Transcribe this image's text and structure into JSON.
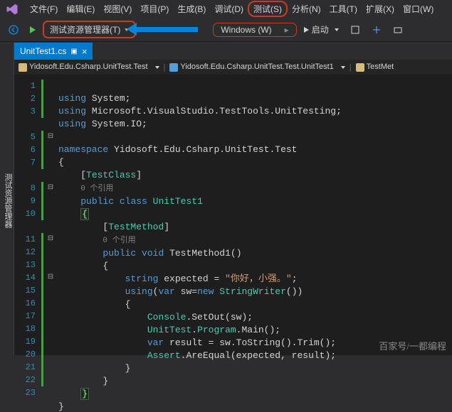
{
  "menu": {
    "items": [
      "文件(F)",
      "编辑(E)",
      "视图(V)",
      "项目(P)",
      "生成(B)",
      "调试(D)",
      "测试(S)",
      "分析(N)",
      "工具(T)",
      "扩展(X)",
      "窗口(W)"
    ],
    "highlight_index": 6
  },
  "toolbar": {
    "test_explorer": "测试资源管理器(T)",
    "config": "Windows (W)",
    "start": "启动"
  },
  "sidebar": {
    "label": "测试资源管理器"
  },
  "tab": {
    "filename": "UnitTest1.cs"
  },
  "breadcrumb": {
    "ns": "Yidosoft.Edu.Csharp.UnitTest.Test",
    "cls": "Yidosoft.Edu.Csharp.UnitTest.Test.UnitTest1",
    "mth": "TestMet"
  },
  "code": {
    "l1": {
      "kw": "using",
      "ns": "System;"
    },
    "l2": {
      "kw": "using",
      "ns": "Microsoft.VisualStudio.TestTools.UnitTesting;"
    },
    "l3": {
      "kw": "using",
      "ns": "System.IO;"
    },
    "l5": {
      "kw": "namespace",
      "ns": "Yidosoft.Edu.Csharp.UnitTest.Test"
    },
    "l7a": "TestClass",
    "l7r": "0 个引用",
    "l8": {
      "kw1": "public",
      "kw2": "class",
      "nm": "UnitTest1"
    },
    "l10a": "TestMethod",
    "l10r": "0 个引用",
    "l11": {
      "kw1": "public",
      "kw2": "void",
      "nm": "TestMethod1()"
    },
    "l13": {
      "kw": "string",
      "var": "expected = ",
      "str": "\"你好，小强。\"",
      "end": ";"
    },
    "l14": {
      "kw1": "using",
      "p": "(",
      "kw2": "var",
      "mid": " sw=",
      "kw3": "new",
      "t": "StringWriter",
      "end": "())"
    },
    "l16": {
      "t": "Console",
      "m": ".SetOut(sw);"
    },
    "l17": {
      "t1": "UnitTest",
      "d1": ".",
      "t2": "Program",
      "m": ".Main();"
    },
    "l18": {
      "kw": "var",
      "rest": " result = sw.ToString().Trim();"
    },
    "l19": {
      "t": "Assert",
      "m": ".AreEqual(expected, result);"
    }
  },
  "watermark": "百家号/一都编程"
}
